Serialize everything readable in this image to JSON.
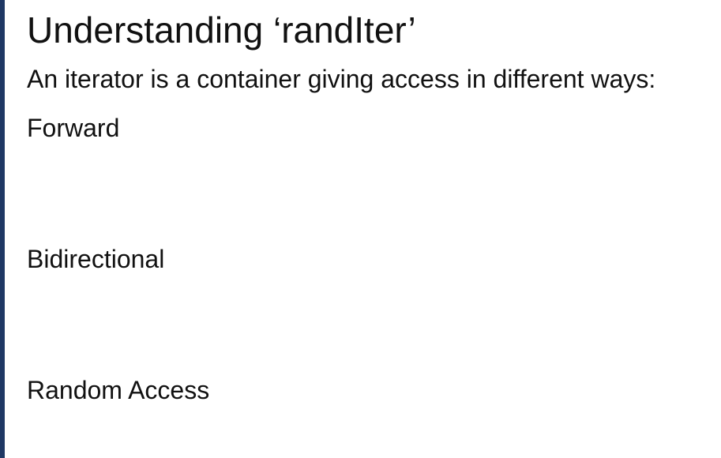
{
  "slide": {
    "title": "Understanding ‘randIter’",
    "intro": "An iterator is a container giving access in different ways:",
    "items": [
      {
        "label": "Forward"
      },
      {
        "label": "Bidirectional"
      },
      {
        "label": "Random Access"
      }
    ]
  },
  "colors": {
    "accent_bar": "#1f3864",
    "text": "#111111",
    "background": "#ffffff"
  }
}
